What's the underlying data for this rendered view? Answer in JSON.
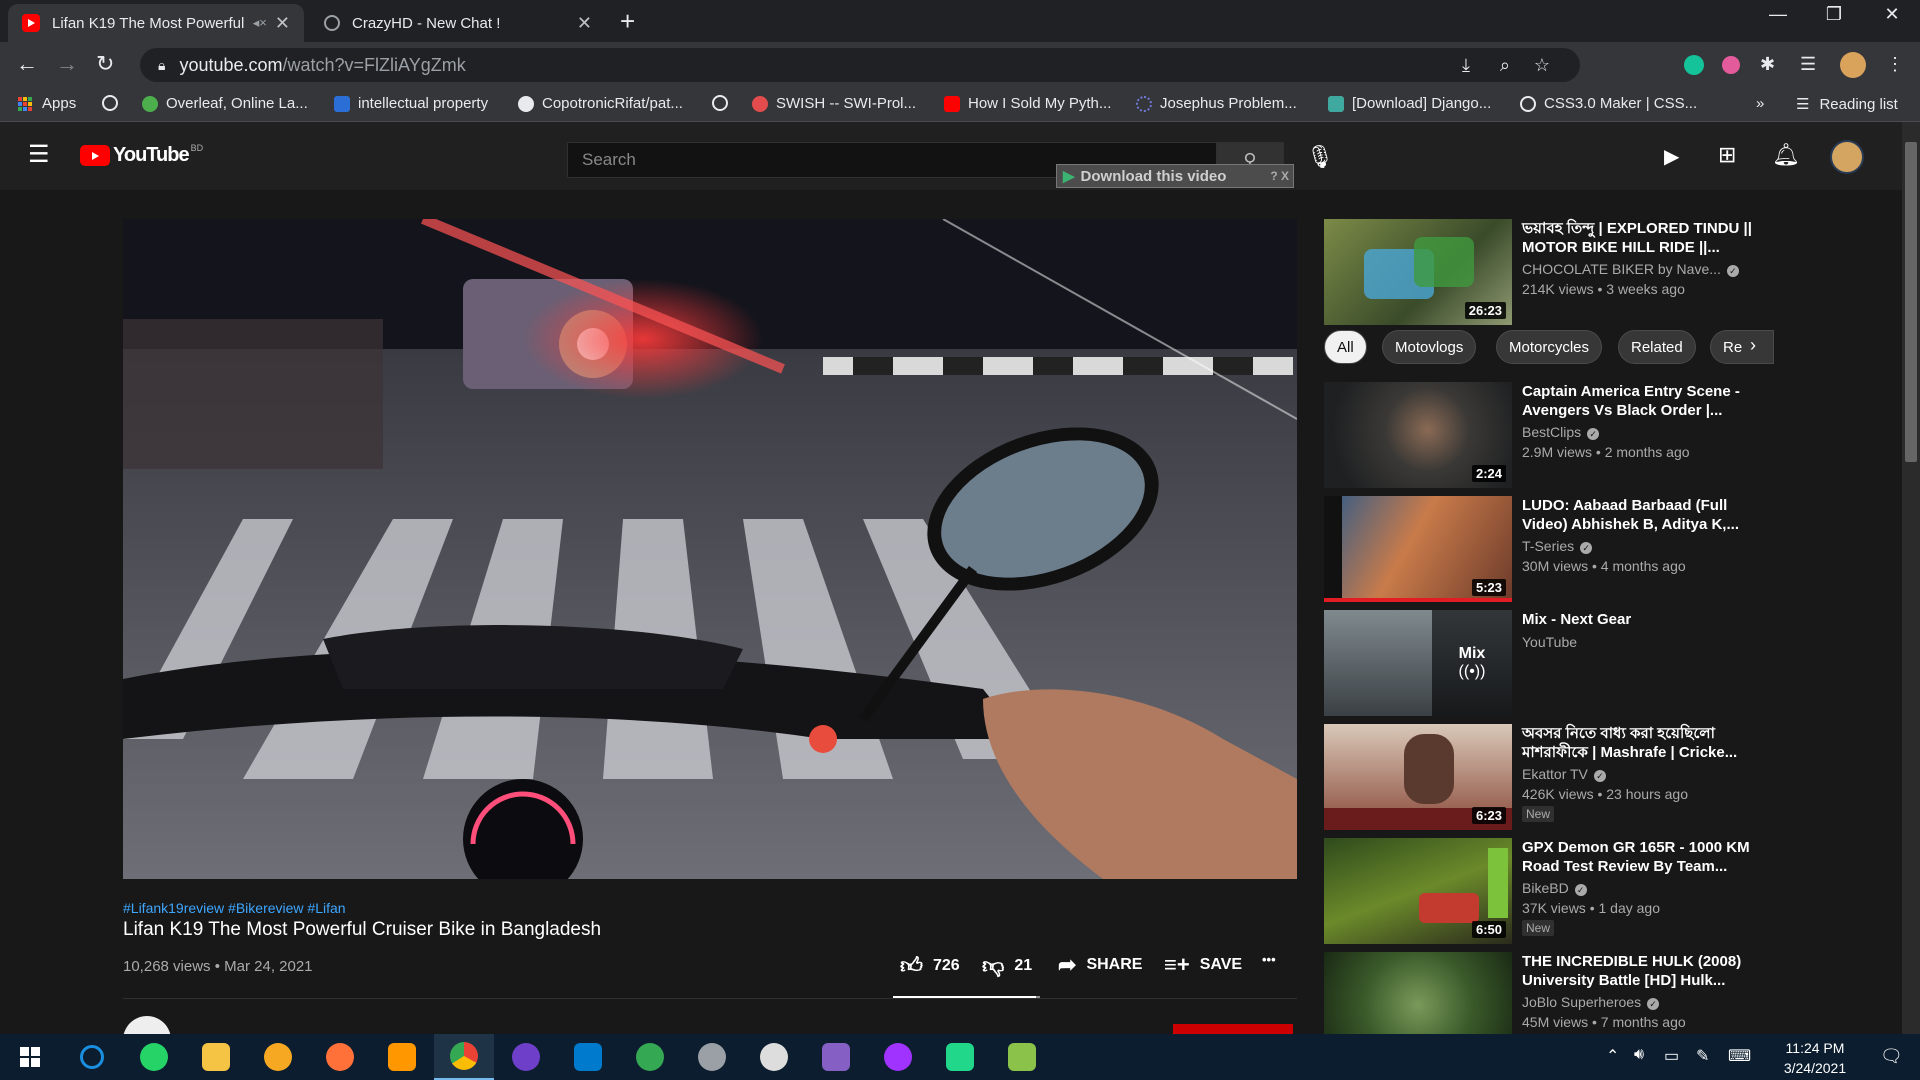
{
  "browser": {
    "tabs": [
      {
        "title": "Lifan K19 The Most Powerful",
        "active": true
      },
      {
        "title": "CrazyHD - New Chat !",
        "active": false
      }
    ],
    "new_tab_icon": "plus",
    "window_controls": [
      "minimize",
      "maximize",
      "close"
    ],
    "url_domain": "youtube.com",
    "url_path": "/watch?v=FlZliAYgZmk",
    "bookmarks": [
      {
        "label": "Apps",
        "icon": "apps-grid",
        "color": "#ea4335"
      },
      {
        "label": "",
        "icon": "globe",
        "color": "#e8eaed"
      },
      {
        "label": "Overleaf, Online La...",
        "icon": "overleaf",
        "color": "#4cae4c"
      },
      {
        "label": "intellectual property",
        "icon": "s-logo",
        "color": "#2b6fd6"
      },
      {
        "label": "CopotronicRifat/pat...",
        "icon": "github",
        "color": "#e8eaed"
      },
      {
        "label": "",
        "icon": "globe",
        "color": "#e8eaed"
      },
      {
        "label": "SWISH -- SWI-Prol...",
        "icon": "swish",
        "color": "#e34c4c"
      },
      {
        "label": "How I Sold My Pyth...",
        "icon": "youtube",
        "color": "#ff0000"
      },
      {
        "label": "Josephus Problem...",
        "icon": "loading",
        "color": "#6f7bd6"
      },
      {
        "label": "[Download] Django...",
        "icon": "django",
        "color": "#3fa9a0"
      },
      {
        "label": "CSS3.0 Maker | CSS...",
        "icon": "globe",
        "color": "#e8eaed"
      }
    ],
    "reading_list": "Reading list",
    "more": "»"
  },
  "youtube": {
    "logo_text": "YouTube",
    "country": "BD",
    "search_placeholder": "Search",
    "download_button": "Download this video",
    "download_extra": "? X"
  },
  "video": {
    "hashtags": "#Lifank19review #Bikereview #Lifan",
    "title": "Lifan K19 The Most Powerful Cruiser Bike in Bangladesh",
    "views_date": "10,268 views • Mar 24, 2021",
    "likes": "726",
    "dislikes": "21",
    "like_ratio": 0.97,
    "share": "SHARE",
    "save": "SAVE",
    "more": "•••"
  },
  "chips": [
    "All",
    "Motovlogs",
    "Motorcycles",
    "Related",
    "Re"
  ],
  "recommendations": [
    {
      "title": "ভয়াবহ তিন্দু | EXPLORED TINDU || MOTOR BIKE HILL RIDE ||...",
      "channel": "CHOCOLATE BIKER by Nave...",
      "verified": true,
      "meta": "214K views • 3 weeks ago",
      "duration": "26:23",
      "new": false,
      "thumb_color": "#6b7a3a"
    },
    {
      "title": "Captain America Entry Scene - Avengers Vs Black Order |...",
      "channel": "BestClips",
      "verified": true,
      "meta": "2.9M views • 2 months ago",
      "duration": "2:24",
      "new": false,
      "thumb_color": "#3b3a38"
    },
    {
      "title": "LUDO: Aabaad Barbaad (Full Video) Abhishek B, Aditya K,...",
      "channel": "T-Series",
      "verified": true,
      "meta": "30M views • 4 months ago",
      "duration": "5:23",
      "new": false,
      "thumb_color": "#b86a3a"
    },
    {
      "title": "Mix - Next Gear",
      "channel": "YouTube",
      "verified": false,
      "meta": "",
      "duration": "",
      "mix": "Mix",
      "new": false,
      "thumb_color": "#5a5f63"
    },
    {
      "title": "অবসর নিতে বাধ্য করা হয়েছিলো মাশরাফীকে | Mashrafe | Cricke...",
      "channel": "Ekattor TV",
      "verified": true,
      "meta": "426K views • 23 hours ago",
      "duration": "6:23",
      "new": true,
      "thumb_color": "#8c5140"
    },
    {
      "title": "GPX Demon GR 165R - 1000 KM Road Test Review By Team...",
      "channel": "BikeBD",
      "verified": true,
      "meta": "37K views • 1 day ago",
      "duration": "6:50",
      "new": true,
      "thumb_color": "#3e5a22"
    },
    {
      "title": "THE INCREDIBLE HULK (2008) University Battle [HD] Hulk...",
      "channel": "JoBlo Superheroes",
      "verified": true,
      "meta": "45M views • 7 months ago",
      "duration": "",
      "new": false,
      "thumb_color": "#4d6a3a"
    }
  ],
  "new_label": "New",
  "taskbar": {
    "apps": [
      {
        "name": "start",
        "color": "#ffffff"
      },
      {
        "name": "cortana",
        "color": "#1a8fe0"
      },
      {
        "name": "whatsapp",
        "color": "#25d366"
      },
      {
        "name": "file-explorer",
        "color": "#f6c445"
      },
      {
        "name": "avast",
        "color": "#f7a823"
      },
      {
        "name": "firefox",
        "color": "#ff7139"
      },
      {
        "name": "sublime",
        "color": "#ff9800"
      },
      {
        "name": "chrome",
        "color": "#4285f4"
      },
      {
        "name": "github-desktop",
        "color": "#6e40c9"
      },
      {
        "name": "vscode",
        "color": "#007acc"
      },
      {
        "name": "photos",
        "color": "#34a853"
      },
      {
        "name": "paint",
        "color": "#9aa0a6"
      },
      {
        "name": "inkscape",
        "color": "#dddddd"
      },
      {
        "name": "visual-studio",
        "color": "#865fc5"
      },
      {
        "name": "messenger",
        "color": "#a033ff"
      },
      {
        "name": "pycharm",
        "color": "#21d789"
      },
      {
        "name": "notepad",
        "color": "#8bc34a"
      }
    ],
    "time": "11:24 PM",
    "date": "3/24/2021"
  }
}
